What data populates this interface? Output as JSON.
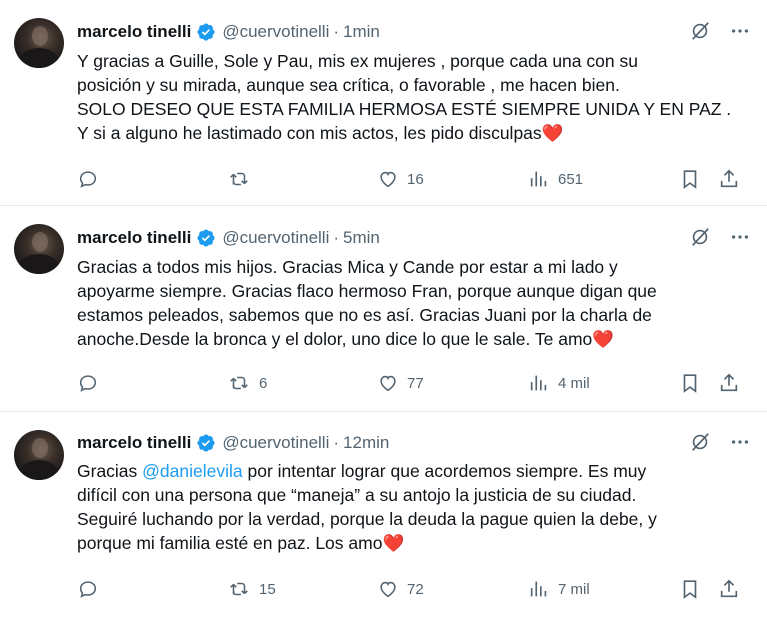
{
  "tweets": [
    {
      "user": {
        "name": "marcelo tinelli",
        "handle": "@cuervotinelli"
      },
      "time": "1min",
      "lines": [
        "Y gracias a Guille, Sole y Pau, mis ex mujeres , porque cada una con su",
        "posición y su mirada, aunque sea crítica, o favorable , me hacen bien.",
        "SOLO DESEO QUE ESTA FAMILIA HERMOSA ESTÉ SIEMPRE UNIDA Y EN PAZ .",
        "Y si a alguno he lastimado con mis actos, les pido disculpas"
      ],
      "stats": {
        "replies": "",
        "retweets": "",
        "likes": "16",
        "views": "651"
      }
    },
    {
      "user": {
        "name": "marcelo tinelli",
        "handle": "@cuervotinelli"
      },
      "time": "5min",
      "lines": [
        "Gracias a todos mis hijos. Gracias Mica y Cande por estar a mi lado y",
        "apoyarme siempre. Gracias flaco hermoso Fran, porque aunque digan que",
        "estamos peleados, sabemos que no es así. Gracias Juani por la charla de",
        "anoche.Desde la bronca y el dolor, uno dice lo que le sale. Te amo"
      ],
      "stats": {
        "replies": "",
        "retweets": "6",
        "likes": "77",
        "views": "4 mil"
      }
    },
    {
      "user": {
        "name": "marcelo tinelli",
        "handle": "@cuervotinelli"
      },
      "time": "12min",
      "line1_prefix": "Gracias ",
      "mention": "@danielevila",
      "line1_suffix": " por intentar lograr que acordemos siempre. Es muy",
      "lines": [
        "difícil con una persona que “maneja” a su antojo la justicia de su ciudad.",
        "Seguiré luchando por la verdad, porque la deuda la pague quien la debe, y",
        "porque mi familia esté en paz. Los amo"
      ],
      "stats": {
        "replies": "",
        "retweets": "15",
        "likes": "72",
        "views": "7 mil"
      }
    }
  ],
  "separator": "·",
  "emoji": "❤️",
  "colors": {
    "text": "#0f1419",
    "secondary": "#536471",
    "verified": "#1d9bf0",
    "mention": "#1d9bf0",
    "heart": "#e0245e"
  },
  "icons": [
    "verified-badge-icon",
    "grok-icon",
    "more-icon",
    "reply-icon",
    "retweet-icon",
    "like-icon",
    "views-icon",
    "bookmark-icon",
    "share-icon"
  ]
}
